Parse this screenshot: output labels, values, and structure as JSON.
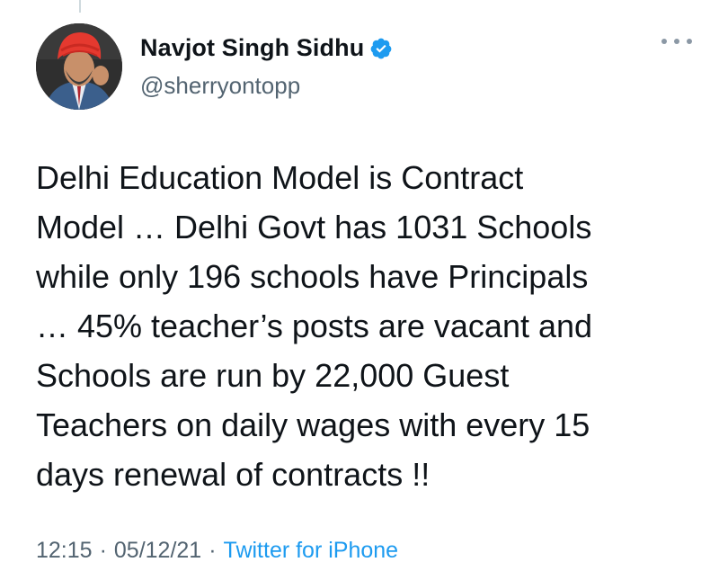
{
  "tweet": {
    "author": {
      "display_name": "Navjot Singh Sidhu",
      "handle": "@sherryontopp",
      "verified": true
    },
    "icons": {
      "verified": "verified-badge-icon",
      "more": "more-options-icon"
    },
    "text": "Delhi Education Model is Contract\nModel … Delhi Govt has 1031 Schools\nwhile only 196 schools have Principals\n… 45% teacher’s posts are vacant and\nSchools are run by 22,000 Guest\nTeachers on daily wages with every 15\ndays renewal of contracts !!",
    "time": "12:15",
    "date": "05/12/21",
    "separator": "·",
    "source": "Twitter for iPhone"
  },
  "colors": {
    "text": "#0f1419",
    "secondary": "#536471",
    "link": "#1d9bf0",
    "verified": "#1d9bf0"
  }
}
